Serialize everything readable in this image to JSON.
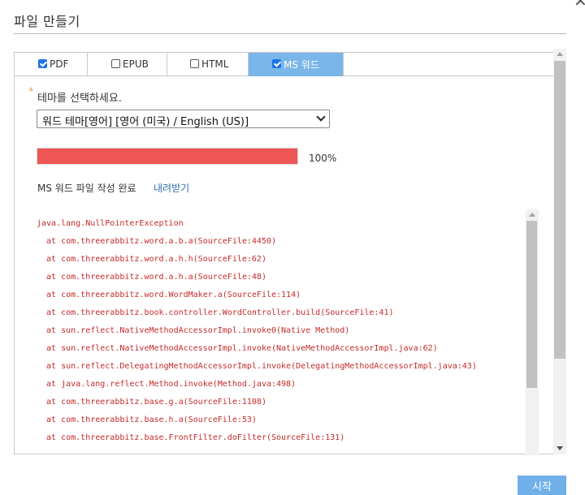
{
  "dialog": {
    "title": "파일 만들기",
    "close_glyph": "✕"
  },
  "tabs": [
    {
      "label": "PDF",
      "checked": true,
      "active": false
    },
    {
      "label": "EPUB",
      "checked": false,
      "active": false
    },
    {
      "label": "HTML",
      "checked": false,
      "active": false
    },
    {
      "label": "MS 워드",
      "checked": true,
      "active": true
    }
  ],
  "theme": {
    "required_mark": "*",
    "label": "테마를 선택하세요.",
    "selected": "워드 테마[영어] [영어 (미국) / English (US)]"
  },
  "progress": {
    "percent": 100,
    "text": "100%"
  },
  "status": {
    "message": "MS 워드 파일 작성 완료",
    "download_label": "내려받기"
  },
  "log": {
    "lines": [
      "java.lang.NullPointerException",
      "  at com.threerabbitz.word.a.b.a(SourceFile:4450)",
      "  at com.threerabbitz.word.a.h.h(SourceFile:62)",
      "  at com.threerabbitz.word.a.h.a(SourceFile:48)",
      "  at com.threerabbitz.word.WordMaker.a(SourceFile:114)",
      "  at com.threerabbitz.book.controller.WordController.build(SourceFile:41)",
      "  at sun.reflect.NativeMethodAccessorImpl.invoke0(Native Method)",
      "  at sun.reflect.NativeMethodAccessorImpl.invoke(NativeMethodAccessorImpl.java:62)",
      "  at sun.reflect.DelegatingMethodAccessorImpl.invoke(DelegatingMethodAccessorImpl.java:43)",
      "  at java.lang.reflect.Method.invoke(Method.java:498)",
      "  at com.threerabbitz.base.g.a(SourceFile:1108)",
      "  at com.threerabbitz.base.h.a(SourceFile:53)",
      "  at com.threerabbitz.base.FrontFilter.doFilter(SourceFile:131)"
    ]
  },
  "footer": {
    "start_label": "시작"
  },
  "colors": {
    "accent": "#7ab6e8",
    "progress": "#ef5656",
    "error_text": "#c52a2a",
    "link": "#2f6fb0"
  }
}
